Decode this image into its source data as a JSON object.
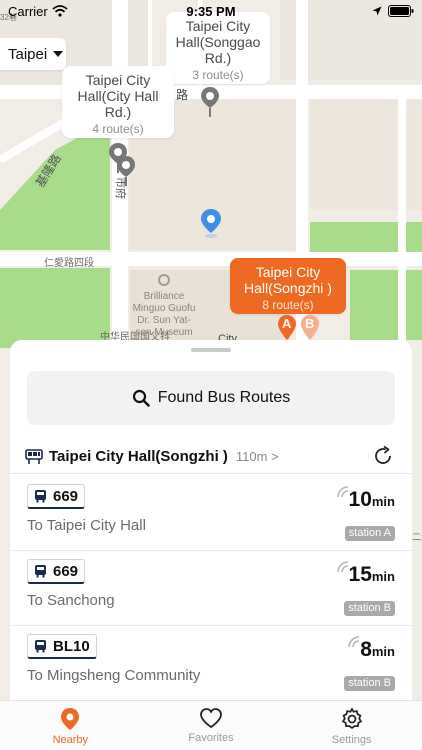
{
  "status_bar": {
    "carrier": "Carrier",
    "time": "9:35 PM"
  },
  "city_selector": {
    "label": "Taipei"
  },
  "map": {
    "street_labels": [
      "路",
      "基隆路",
      "市府",
      "仁愛路四段",
      "中华民国国父抖",
      "City",
      "32巷",
      "二大"
    ],
    "poi_label": "Brilliance\nMinguo Guofu\nDr. Sun Yat-\nsen Museum",
    "stop_cards": [
      {
        "name": "Taipei City Hall(Songgao Rd.)",
        "routes": "3 route(s)",
        "active": false
      },
      {
        "name": "Taipei City Hall(City Hall Rd.)",
        "routes": "4 route(s)",
        "active": false
      },
      {
        "name": "Taipei City Hall(Songzhi )",
        "routes": "8 route(s)",
        "active": true
      }
    ],
    "stop_pin_letters": [
      "A",
      "B"
    ]
  },
  "sheet": {
    "found_button": "Found Bus Routes",
    "stop_title": "Taipei City Hall(Songzhi )",
    "stop_distance": "110m >",
    "routes": [
      {
        "number": "669",
        "destination": "To Taipei City Hall",
        "eta_value": "10",
        "eta_unit": "min",
        "station": "station A"
      },
      {
        "number": "669",
        "destination": "To Sanchong",
        "eta_value": "15",
        "eta_unit": "min",
        "station": "station B"
      },
      {
        "number": "BL10",
        "destination": "To Mingsheng Community",
        "eta_value": "8",
        "eta_unit": "min",
        "station": "station B"
      }
    ]
  },
  "tabs": [
    {
      "label": "Nearby",
      "icon": "location-pin-icon",
      "active": true
    },
    {
      "label": "Favorites",
      "icon": "heart-icon",
      "active": false
    },
    {
      "label": "Settings",
      "icon": "gear-icon",
      "active": false
    }
  ],
  "colors": {
    "accent": "#ee6a23",
    "pin_gray": "#777777",
    "user_location": "#3f8fe8",
    "park_green": "#a7dc8a"
  }
}
